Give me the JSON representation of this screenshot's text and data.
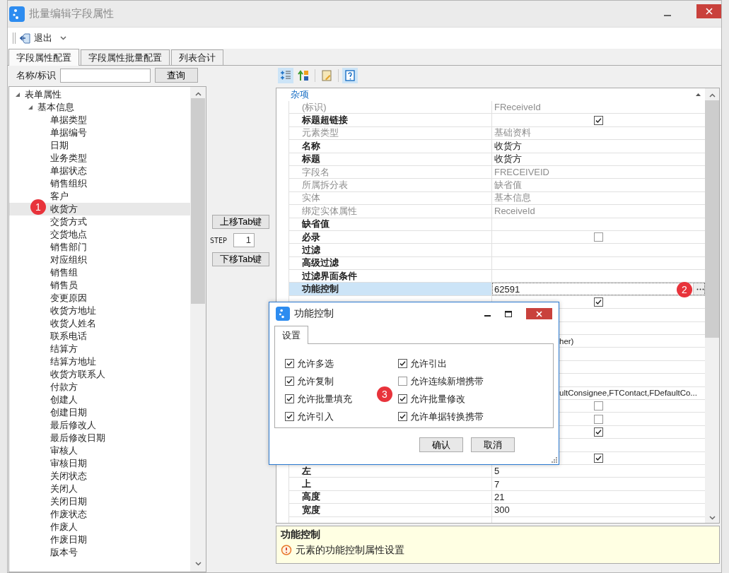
{
  "window": {
    "title": "批量编辑字段属性"
  },
  "toolbar": [
    {
      "label": "退出"
    }
  ],
  "tabs": [
    {
      "label": "字段属性配置",
      "selected": true
    },
    {
      "label": "字段属性批量配置",
      "selected": false
    },
    {
      "label": "列表合计",
      "selected": false
    }
  ],
  "search": {
    "label": "名称/标识",
    "button": "查询"
  },
  "tree": [
    {
      "label": "表单属性",
      "expanded": true,
      "selected": false,
      "children": [
        {
          "label": "基本信息",
          "expanded": true,
          "selected": false,
          "children": [
            {
              "label": "单据类型",
              "selected": false
            },
            {
              "label": "单据编号",
              "selected": false
            },
            {
              "label": "日期",
              "selected": false
            },
            {
              "label": "业务类型",
              "selected": false
            },
            {
              "label": "单据状态",
              "selected": false
            },
            {
              "label": "销售组织",
              "selected": false
            },
            {
              "label": "客户",
              "selected": false
            },
            {
              "label": "收货方",
              "selected": true
            },
            {
              "label": "交货方式",
              "selected": false
            },
            {
              "label": "交货地点",
              "selected": false
            },
            {
              "label": "销售部门",
              "selected": false
            },
            {
              "label": "对应组织",
              "selected": false
            },
            {
              "label": "销售组",
              "selected": false
            },
            {
              "label": "销售员",
              "selected": false
            },
            {
              "label": "变更原因",
              "selected": false
            },
            {
              "label": "收货方地址",
              "selected": false
            },
            {
              "label": "收货人姓名",
              "selected": false
            },
            {
              "label": "联系电话",
              "selected": false
            },
            {
              "label": "结算方",
              "selected": false
            },
            {
              "label": "结算方地址",
              "selected": false
            },
            {
              "label": "收货方联系人",
              "selected": false
            },
            {
              "label": "付款方",
              "selected": false
            },
            {
              "label": "创建人",
              "selected": false
            },
            {
              "label": "创建日期",
              "selected": false
            },
            {
              "label": "最后修改人",
              "selected": false
            },
            {
              "label": "最后修改日期",
              "selected": false
            },
            {
              "label": "审核人",
              "selected": false
            },
            {
              "label": "审核日期",
              "selected": false
            },
            {
              "label": "关闭状态",
              "selected": false
            },
            {
              "label": "关闭人",
              "selected": false
            },
            {
              "label": "关闭日期",
              "selected": false
            },
            {
              "label": "作废状态",
              "selected": false
            },
            {
              "label": "作废人",
              "selected": false
            },
            {
              "label": "作废日期",
              "selected": false
            },
            {
              "label": "版本号",
              "selected": false
            }
          ]
        }
      ]
    }
  ],
  "tab_order": {
    "up_button": "上移Tab键",
    "step_label": "STEP",
    "step_value": "1",
    "down_button": "下移Tab键"
  },
  "prop_toolbar": [
    {
      "kind": "categorized",
      "selected": true
    },
    {
      "kind": "alphabetical",
      "selected": false
    },
    {
      "kind": "pages",
      "selected": false
    },
    {
      "kind": "help",
      "selected": true
    }
  ],
  "property_grid": {
    "category": "杂项",
    "rows": [
      {
        "kind": "text",
        "label": "(标识)",
        "value": "FReceiveId",
        "disabled": true,
        "selected": false
      },
      {
        "kind": "check",
        "label": "标题超链接",
        "checked": true,
        "disabled": false,
        "selected": false
      },
      {
        "kind": "text",
        "label": "元素类型",
        "value": "基础资料",
        "disabled": true,
        "selected": false
      },
      {
        "kind": "text",
        "label": "名称",
        "value": "收货方",
        "disabled": false,
        "selected": false
      },
      {
        "kind": "text",
        "label": "标题",
        "value": "收货方",
        "disabled": false,
        "selected": false
      },
      {
        "kind": "text",
        "label": "字段名",
        "value": "FRECEIVEID",
        "disabled": true,
        "selected": false
      },
      {
        "kind": "text",
        "label": "所属拆分表",
        "value": "缺省值",
        "disabled": true,
        "selected": false
      },
      {
        "kind": "text",
        "label": "实体",
        "value": "基本信息",
        "disabled": true,
        "selected": false
      },
      {
        "kind": "text",
        "label": "绑定实体属性",
        "value": "ReceiveId",
        "disabled": true,
        "selected": false
      },
      {
        "kind": "text",
        "label": "缺省值",
        "disabled": false,
        "selected": false
      },
      {
        "kind": "check",
        "label": "必录",
        "checked": false,
        "disabled": false,
        "selected": false
      },
      {
        "kind": "text",
        "label": "过滤",
        "disabled": false,
        "selected": false
      },
      {
        "kind": "text",
        "label": "高级过滤",
        "disabled": false,
        "selected": false
      },
      {
        "kind": "text",
        "label": "过滤界面条件",
        "disabled": false,
        "selected": false
      },
      {
        "kind": "button",
        "label": "功能控制",
        "value": "62591",
        "disabled": false,
        "selected": true
      },
      {
        "kind": "covered_check",
        "checked": true
      },
      {
        "kind": "covered_text"
      },
      {
        "kind": "covered_text"
      },
      {
        "kind": "covered_text",
        "value": "her)"
      },
      {
        "kind": "covered_text"
      },
      {
        "kind": "covered_text"
      },
      {
        "kind": "covered_text"
      },
      {
        "kind": "covered_text",
        "value": "ultConsignee,FTContact,FDefaultCo..."
      },
      {
        "kind": "covered_check",
        "checked": false
      },
      {
        "kind": "covered_check",
        "checked": false
      },
      {
        "kind": "covered_check",
        "checked": true
      },
      {
        "kind": "covered_text"
      },
      {
        "kind": "covered_check",
        "checked": true
      },
      {
        "kind": "text",
        "label": "左",
        "value": "5",
        "disabled": false,
        "selected": false
      },
      {
        "kind": "text",
        "label": "上",
        "value": "7",
        "disabled": false,
        "selected": false
      },
      {
        "kind": "text",
        "label": "高度",
        "value": "21",
        "disabled": false,
        "selected": false
      },
      {
        "kind": "text",
        "label": "宽度",
        "value": "300",
        "disabled": false,
        "selected": false
      },
      {
        "kind": "text"
      }
    ]
  },
  "description": {
    "title": "功能控制",
    "text": "元素的功能控制属性设置"
  },
  "dialog": {
    "title": "功能控制",
    "tab": "设置",
    "options": [
      {
        "label": "允许多选",
        "checked": true
      },
      {
        "label": "允许复制",
        "checked": true
      },
      {
        "label": "允许批量填充",
        "checked": true
      },
      {
        "label": "允许引入",
        "checked": true
      },
      {
        "label": "允许引出",
        "checked": true
      },
      {
        "label": "允许连续新增携带",
        "checked": false
      },
      {
        "label": "允许批量修改",
        "checked": true
      },
      {
        "label": "允许单据转换携带",
        "checked": true
      }
    ],
    "buttons": [
      "确认",
      "取消"
    ]
  },
  "markers": [
    {
      "number": "1"
    },
    {
      "number": "2"
    },
    {
      "number": "3"
    }
  ]
}
